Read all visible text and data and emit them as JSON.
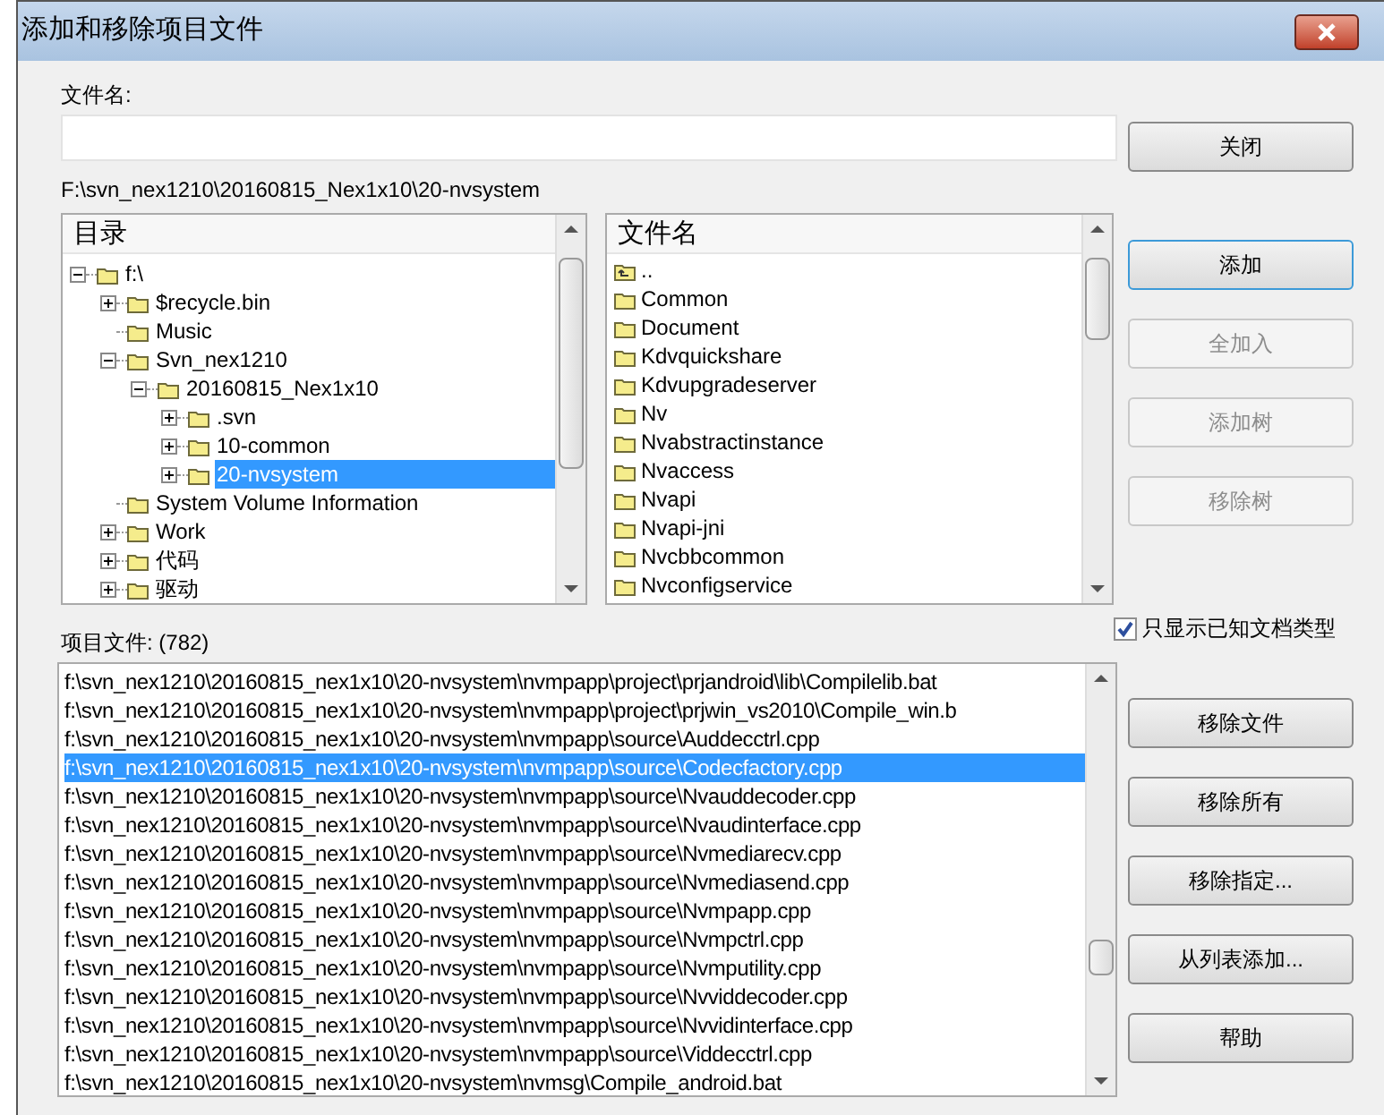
{
  "window": {
    "title": "添加和移除项目文件"
  },
  "filename": {
    "label": "文件名:"
  },
  "current_path": "F:\\svn_nex1210\\20160815_Nex1x10\\20-nvsystem",
  "directory_tree": {
    "header": "目录",
    "items": [
      {
        "label": "f:\\",
        "expanded": true,
        "selected": false,
        "children": [
          {
            "label": "$recycle.bin",
            "expanded": false,
            "selected": false
          },
          {
            "label": "Music",
            "selected": false
          },
          {
            "label": "Svn_nex1210",
            "expanded": true,
            "selected": false,
            "children": [
              {
                "label": "20160815_Nex1x10",
                "expanded": true,
                "selected": false,
                "children": [
                  {
                    "label": ".svn",
                    "expanded": false,
                    "selected": false
                  },
                  {
                    "label": "10-common",
                    "expanded": false,
                    "selected": false
                  },
                  {
                    "label": "20-nvsystem",
                    "expanded": false,
                    "selected": true
                  }
                ]
              }
            ]
          },
          {
            "label": "System Volume Information",
            "selected": false
          },
          {
            "label": "Work",
            "expanded": false,
            "selected": false
          },
          {
            "label": "代码",
            "expanded": false,
            "selected": false
          },
          {
            "label": "驱动",
            "expanded": false,
            "selected": false
          }
        ]
      }
    ]
  },
  "file_list": {
    "header": "文件名",
    "items": [
      {
        "label": "..",
        "kind": "parent"
      },
      {
        "label": "Common",
        "kind": "folder"
      },
      {
        "label": "Document",
        "kind": "folder"
      },
      {
        "label": "Kdvquickshare",
        "kind": "folder"
      },
      {
        "label": "Kdvupgradeserver",
        "kind": "folder"
      },
      {
        "label": "Nv",
        "kind": "folder"
      },
      {
        "label": "Nvabstractinstance",
        "kind": "folder"
      },
      {
        "label": "Nvaccess",
        "kind": "folder"
      },
      {
        "label": "Nvapi",
        "kind": "folder"
      },
      {
        "label": "Nvapi-jni",
        "kind": "folder"
      },
      {
        "label": "Nvcbbcommon",
        "kind": "folder"
      },
      {
        "label": "Nvconfigservice",
        "kind": "folder"
      }
    ]
  },
  "project_files": {
    "label": "项目文件: (782)",
    "rows": [
      {
        "path": "f:\\svn_nex1210\\20160815_nex1x10\\20-nvsystem\\nvmpapp\\project\\prjandroid\\lib\\Compilelib.bat",
        "selected": false
      },
      {
        "path": "f:\\svn_nex1210\\20160815_nex1x10\\20-nvsystem\\nvmpapp\\project\\prjwin_vs2010\\Compile_win.b",
        "selected": false
      },
      {
        "path": "f:\\svn_nex1210\\20160815_nex1x10\\20-nvsystem\\nvmpapp\\source\\Auddecctrl.cpp",
        "selected": false
      },
      {
        "path": "f:\\svn_nex1210\\20160815_nex1x10\\20-nvsystem\\nvmpapp\\source\\Codecfactory.cpp",
        "selected": true
      },
      {
        "path": "f:\\svn_nex1210\\20160815_nex1x10\\20-nvsystem\\nvmpapp\\source\\Nvauddecoder.cpp",
        "selected": false
      },
      {
        "path": "f:\\svn_nex1210\\20160815_nex1x10\\20-nvsystem\\nvmpapp\\source\\Nvaudinterface.cpp",
        "selected": false
      },
      {
        "path": "f:\\svn_nex1210\\20160815_nex1x10\\20-nvsystem\\nvmpapp\\source\\Nvmediarecv.cpp",
        "selected": false
      },
      {
        "path": "f:\\svn_nex1210\\20160815_nex1x10\\20-nvsystem\\nvmpapp\\source\\Nvmediasend.cpp",
        "selected": false
      },
      {
        "path": "f:\\svn_nex1210\\20160815_nex1x10\\20-nvsystem\\nvmpapp\\source\\Nvmpapp.cpp",
        "selected": false
      },
      {
        "path": "f:\\svn_nex1210\\20160815_nex1x10\\20-nvsystem\\nvmpapp\\source\\Nvmpctrl.cpp",
        "selected": false
      },
      {
        "path": "f:\\svn_nex1210\\20160815_nex1x10\\20-nvsystem\\nvmpapp\\source\\Nvmputility.cpp",
        "selected": false
      },
      {
        "path": "f:\\svn_nex1210\\20160815_nex1x10\\20-nvsystem\\nvmpapp\\source\\Nvviddecoder.cpp",
        "selected": false
      },
      {
        "path": "f:\\svn_nex1210\\20160815_nex1x10\\20-nvsystem\\nvmpapp\\source\\Nvvidinterface.cpp",
        "selected": false
      },
      {
        "path": "f:\\svn_nex1210\\20160815_nex1x10\\20-nvsystem\\nvmpapp\\source\\Viddecctrl.cpp",
        "selected": false
      },
      {
        "path": "f:\\svn_nex1210\\20160815_nex1x10\\20-nvsystem\\nvmsg\\Compile_android.bat",
        "selected": false
      }
    ]
  },
  "top_buttons": [
    {
      "label": "关闭",
      "disabled": false,
      "focused": false
    },
    {
      "label": "添加",
      "disabled": false,
      "focused": true
    },
    {
      "label": "全加入",
      "disabled": true,
      "focused": false
    },
    {
      "label": "添加树",
      "disabled": true,
      "focused": false
    },
    {
      "label": "移除树",
      "disabled": true,
      "focused": false
    }
  ],
  "known_types_checkbox": {
    "label": "只显示已知文档类型",
    "checked": true
  },
  "bottom_buttons": [
    {
      "label": "移除文件",
      "disabled": false,
      "focused": false
    },
    {
      "label": "移除所有",
      "disabled": false,
      "focused": false
    },
    {
      "label": "移除指定...",
      "disabled": false,
      "focused": false
    },
    {
      "label": "从列表添加...",
      "disabled": false,
      "focused": false
    },
    {
      "label": "帮助",
      "disabled": false,
      "focused": false
    }
  ]
}
